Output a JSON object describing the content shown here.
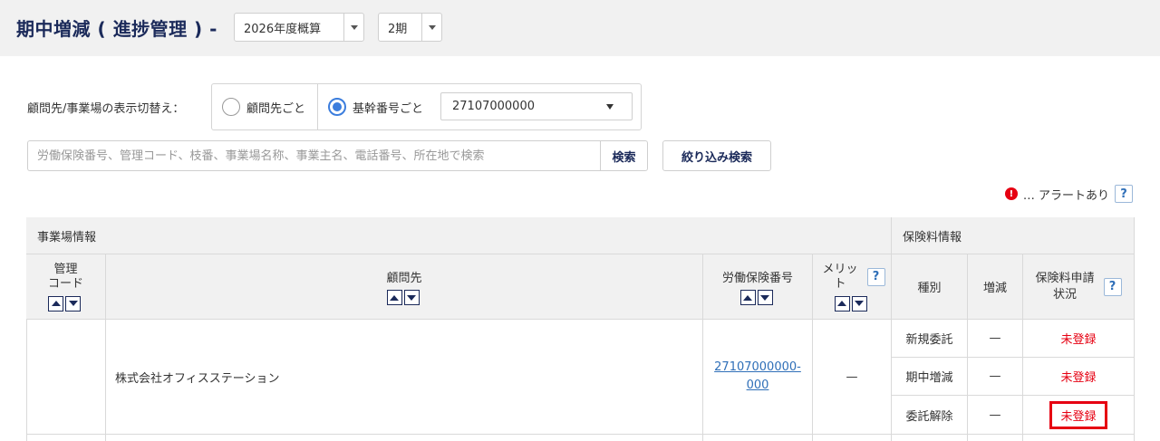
{
  "header": {
    "title": "期中増減 ( 進捗管理 ) -",
    "fiscal_year": "2026年度概算",
    "period": "2期"
  },
  "filter": {
    "label": "顧問先/事業場の表示切替え：",
    "options": [
      {
        "label": "顧問先ごと",
        "selected": false
      },
      {
        "label": "基幹番号ごと",
        "selected": true
      }
    ],
    "base_number": "27107000000"
  },
  "search": {
    "placeholder": "労働保険番号、管理コード、枝番、事業場名称、事業主名、電話番号、所在地で検索",
    "button": "検索",
    "refine_button": "絞り込み検索"
  },
  "legend": {
    "alert_symbol": "!",
    "alert_text": "… アラートあり",
    "help": "?"
  },
  "table": {
    "group_workplace": "事業場情報",
    "group_premium": "保険料情報",
    "col_code": [
      "管理",
      "コード"
    ],
    "col_client": "顧問先",
    "col_insurance_no": "労働保険番号",
    "col_merit": [
      "メリッ",
      "ト"
    ],
    "col_type": "種別",
    "col_change": "増減",
    "col_status": [
      "保険料申請",
      "状況"
    ],
    "help": "?",
    "rows": [
      {
        "code": "",
        "client": "株式会社オフィスステーション",
        "insurance_no": [
          "27107000000-",
          "000"
        ],
        "merit": "—",
        "entries": [
          {
            "type": "新規委託",
            "change": "—",
            "status": "未登録"
          },
          {
            "type": "期中増減",
            "change": "—",
            "status": "未登録"
          },
          {
            "type": "委託解除",
            "change": "—",
            "status": "未登録",
            "highlighted": true
          }
        ]
      }
    ]
  },
  "colors": {
    "brand": "#1b2a5a",
    "link": "#2f6fb8",
    "alert": "#e60012",
    "radio_selected": "#3b7ddd"
  }
}
